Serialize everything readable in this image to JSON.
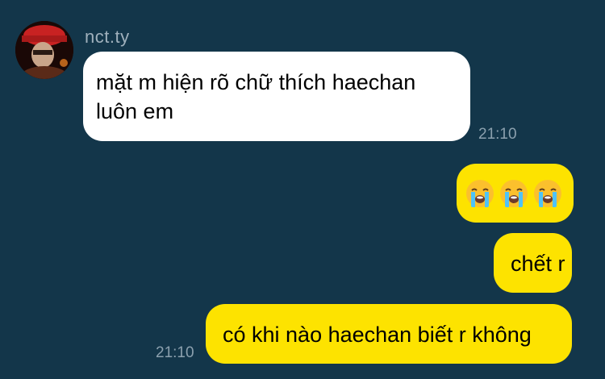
{
  "conversation": {
    "contact_name": "nct.ty",
    "messages": [
      {
        "direction": "incoming",
        "text": "mặt m hiện rõ chữ thích haechan luôn em",
        "time": "21:10"
      },
      {
        "direction": "outgoing",
        "emojis": [
          "loudly-crying-face",
          "loudly-crying-face",
          "loudly-crying-face"
        ]
      },
      {
        "direction": "outgoing",
        "text": "chết r"
      },
      {
        "direction": "outgoing",
        "text": "có khi nào haechan biết r không",
        "time": "21:10"
      }
    ]
  },
  "colors": {
    "background": "#13364a",
    "incoming_bubble": "#ffffff",
    "outgoing_bubble": "#fde300",
    "timestamp": "#8ba0ae",
    "sender_name": "#9fb0bc"
  }
}
